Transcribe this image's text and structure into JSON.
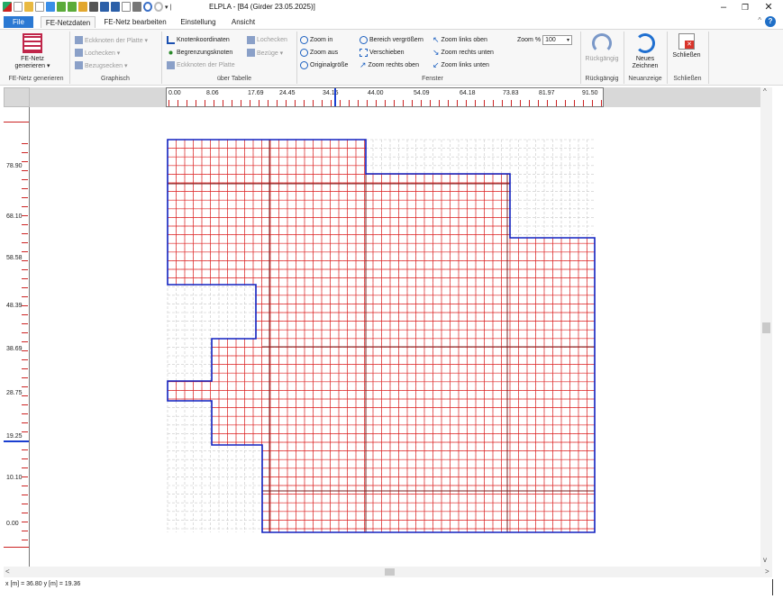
{
  "titlebar": {
    "app_title": "ELPLA - [B4 (Girder 23.05.2025)]",
    "minimize": "–",
    "restore": "❐",
    "close": "✕"
  },
  "tabs": {
    "file": "File",
    "items": [
      "FE-Netzdaten",
      "FE-Netz bearbeiten",
      "Einstellung",
      "Ansicht"
    ],
    "active": "FE-Netzdaten"
  },
  "ribbon": {
    "group1": {
      "button": "FE-Netz generieren ▾",
      "button_l1": "FE-Netz",
      "button_l2": "generieren ▾",
      "label": "FE-Netz generieren"
    },
    "group2": {
      "items": [
        "Eckknoten der Platte ▾",
        "Lochecken ▾",
        "Bezugsecken ▾"
      ],
      "label": "Graphisch"
    },
    "group3": {
      "items": [
        "Knotenkoordinaten",
        "Lochecken",
        "Begrenzungsknoten",
        "Bezüge ▾",
        "Eckknoten der Platte"
      ],
      "label": "über Tabelle"
    },
    "group4": {
      "items": [
        "Zoom in",
        "Zoom aus",
        "Originalgröße",
        "Bereich vergrößern",
        "Verschieben",
        "Zoom rechts oben",
        "Zoom links oben",
        "Zoom rechts unten",
        "Zoom links unten"
      ],
      "zoom_label": "Zoom %",
      "zoom_value": "100",
      "label": "Fenster"
    },
    "group5": {
      "button": "Rückgängig",
      "label": "Rückgängig"
    },
    "group6": {
      "button_l1": "Neues",
      "button_l2": "Zeichnen",
      "label": "Neuanzeige"
    },
    "group7": {
      "button": "Schließen",
      "label": "Schließen"
    }
  },
  "ruler_x": [
    "0.00",
    "8.06",
    "17.69",
    "24.45",
    "34.15",
    "44.00",
    "54.09",
    "64.18",
    "73.83",
    "81.97",
    "91.50"
  ],
  "ruler_y": [
    "78.90",
    "68.10",
    "58.58",
    "48.39",
    "38.69",
    "28.75",
    "19.25",
    "10.10",
    "0.00"
  ],
  "status": {
    "coord": "x [m] = 36.80    y [m] = 19.36"
  },
  "colors": {
    "accent": "#2b79d3",
    "mesh": "#e02020",
    "boundary": "#1020c0",
    "grid": "#c8c8c8"
  }
}
